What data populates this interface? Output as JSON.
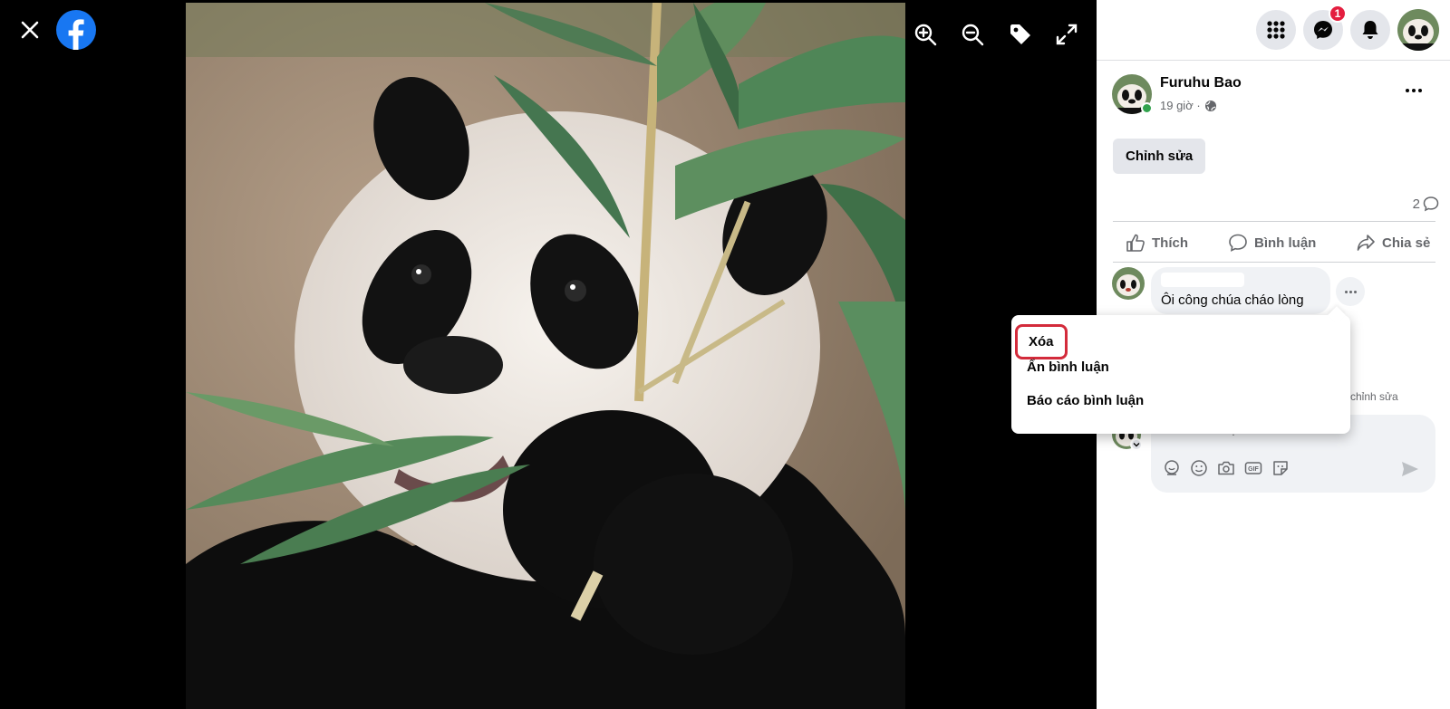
{
  "viewer": {
    "close_icon": "close-icon",
    "logo_icon": "facebook-logo",
    "tools": [
      "zoom-in-icon",
      "zoom-out-icon",
      "tag-icon",
      "fullscreen-icon"
    ],
    "photo_alt": "giant panda eating bamboo leaves"
  },
  "topbar": {
    "menu_icon": "grid-menu-icon",
    "messenger_icon": "messenger-icon",
    "messenger_badge": "1",
    "notifications_icon": "bell-icon",
    "profile_icon": "profile-avatar"
  },
  "post": {
    "author": "Furuhu Bao",
    "time": "19 giờ ·",
    "privacy_icon": "globe-icon",
    "edit_label": "Chỉnh sửa",
    "comment_count": "2"
  },
  "actions": {
    "like": "Thích",
    "comment": "Bình luận",
    "share": "Chia sẻ"
  },
  "comment": {
    "text": "Ôi công chúa cháo lòng",
    "edit_hint": "chỉnh sửa"
  },
  "write_comment": {
    "placeholder": "Viết bình luận...",
    "tools": [
      "avatar-sticker-icon",
      "emoji-icon",
      "camera-icon",
      "gif-icon",
      "sticker-icon"
    ],
    "send_icon": "send-icon"
  },
  "context_menu": {
    "items": [
      "Xóa",
      "Ẩn bình luận",
      "Báo cáo bình luận"
    ],
    "highlight_color": "#d32b3b"
  },
  "colors": {
    "accent": "#1877f2",
    "badge": "#e41e3f",
    "online": "#31a24c"
  }
}
